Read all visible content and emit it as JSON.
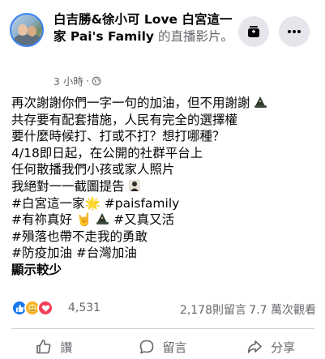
{
  "post": {
    "author": "白吉勝&徐小可 Love 白宮這一家 Pai's Family",
    "action": "的直播影片。",
    "time": "3 小時",
    "dot": "·",
    "lines": [
      "再次謝謝你們一字一句的加油，但不用謝謝",
      "共存要有配套措施，人民有完全的選擇權",
      "要什麼時候打、打或不打？想打哪種？",
      "4/18即日起，在公開的社群平台上",
      "任何散播我們小孩或家人照片",
      "我絕對一一截圖提告",
      "#白宮這一家",
      "#paisfamily",
      "#有祢真好",
      "#又真又活",
      "#殞落也帶不走我的勇敢",
      "#防疫加油 #台灣加油"
    ],
    "sparkle_emoji": "🌟",
    "hand_emoji": "🤘",
    "see_more": "顯示較少"
  },
  "stats": {
    "reaction_count": "4,531",
    "comments": "2,178則留言",
    "views": "7.7 萬次觀看"
  },
  "actions": {
    "like": "讚",
    "comment": "留言",
    "share": "分享"
  },
  "icons": {
    "globe": "globe-icon",
    "stack": "stack-icon",
    "more": "more-icon"
  },
  "colors": {
    "like_blue": "#1877f2",
    "love_red": "#f33e58",
    "care_yellow": "#f7b125",
    "secondary_text": "#65676b"
  }
}
